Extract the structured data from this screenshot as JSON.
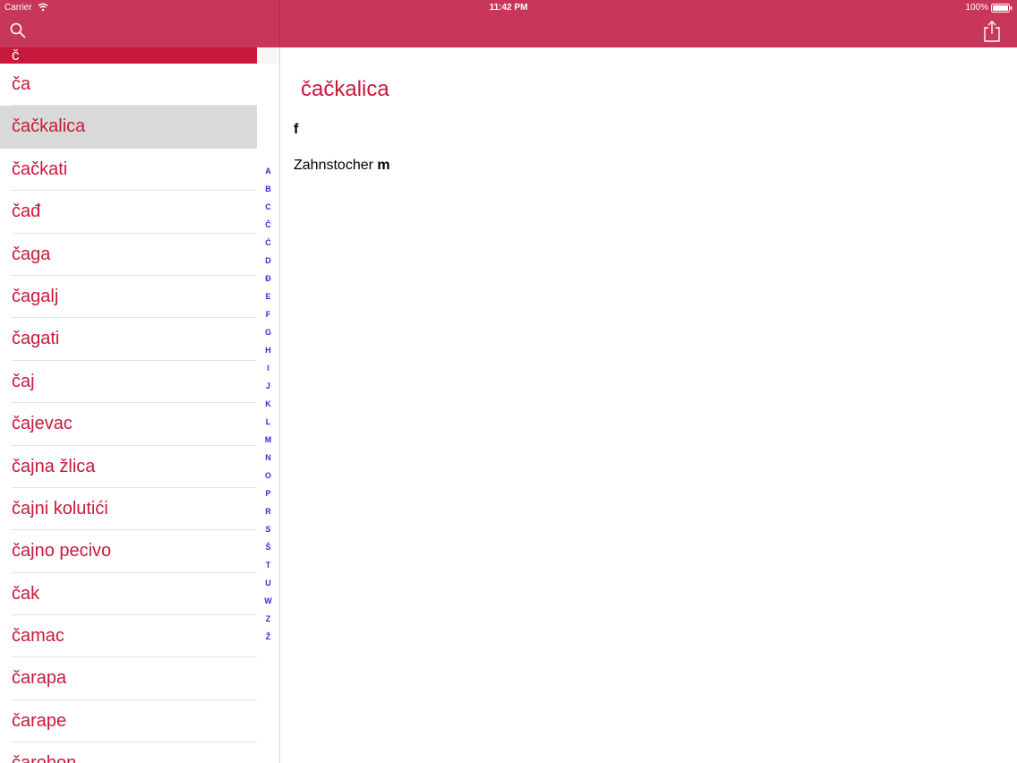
{
  "status_bar": {
    "carrier": "Carrier",
    "time": "11:42 PM",
    "battery": "100%"
  },
  "toolbar": {
    "search_icon": "search-icon",
    "share_icon": "share-icon"
  },
  "section_header": "č",
  "list": {
    "items": [
      {
        "label": "ča"
      },
      {
        "label": "čačkalica",
        "selected": true
      },
      {
        "label": "čačkati"
      },
      {
        "label": "čađ"
      },
      {
        "label": "čaga"
      },
      {
        "label": "čagalj"
      },
      {
        "label": "čagati"
      },
      {
        "label": "čaj"
      },
      {
        "label": "čajevac"
      },
      {
        "label": "čajna žlica"
      },
      {
        "label": "čajni kolutići"
      },
      {
        "label": "čajno pecivo"
      },
      {
        "label": "čak"
      },
      {
        "label": "čamac"
      },
      {
        "label": "čarapa"
      },
      {
        "label": "čarape"
      },
      {
        "label": "čarobon"
      }
    ]
  },
  "index_letters": [
    "A",
    "B",
    "C",
    "Č",
    "Ć",
    "D",
    "Đ",
    "E",
    "F",
    "G",
    "H",
    "I",
    "J",
    "K",
    "L",
    "M",
    "N",
    "O",
    "P",
    "R",
    "S",
    "Š",
    "T",
    "U",
    "W",
    "Z",
    "Ž"
  ],
  "entry": {
    "title": "čačkalica",
    "part_of_speech": "f",
    "translation": "Zahnstocher",
    "translation_gender": "m"
  },
  "colors": {
    "toolbar": "#c8375a",
    "accent": "#c8193c",
    "index": "#2b2bd0",
    "selected_row": "#d9d9d9"
  }
}
